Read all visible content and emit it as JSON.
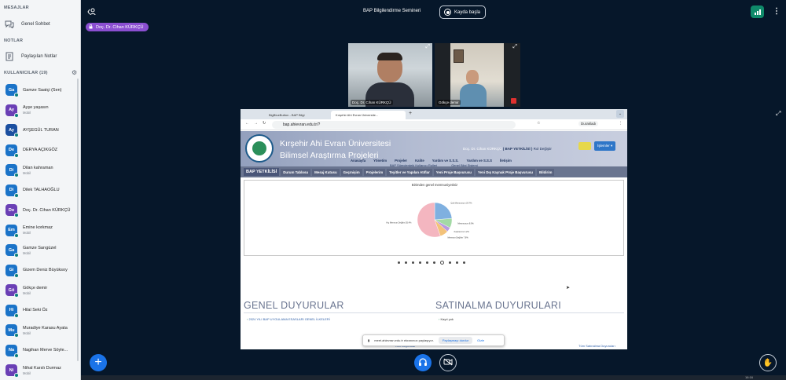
{
  "sidebar": {
    "messages_title": "MESAJLAR",
    "public_chat": "Genel Sohbet",
    "notes_title": "NOTLAR",
    "shared_notes": "Paylaşılan Notlar",
    "users_title": "KULLANICILAR (19)",
    "users": [
      {
        "initials": "Ga",
        "name": "Gamze Saatçi (Sen)",
        "sub": "",
        "color": "#1a73c8"
      },
      {
        "initials": "Ay",
        "name": "Ayşe yaşasın",
        "sub": "Mobil",
        "color": "#6a3fb5"
      },
      {
        "initials": "Ay",
        "name": "AYŞEGÜL TURAN",
        "sub": "",
        "color": "#1b4fa0"
      },
      {
        "initials": "De",
        "name": "DERYA AÇIKGÖZ",
        "sub": "",
        "color": "#1a73c8"
      },
      {
        "initials": "Di",
        "name": "Dilan kahraman",
        "sub": "Mobil",
        "color": "#1a73c8"
      },
      {
        "initials": "Di",
        "name": "Dilek TALHAOĞLU",
        "sub": "",
        "color": "#1a73c8"
      },
      {
        "initials": "Do",
        "name": "Doç. Dr. Cihan KÜRKÇÜ",
        "sub": "",
        "color": "#6a3fb5"
      },
      {
        "initials": "Em",
        "name": "Emine korkmaz",
        "sub": "Mobil",
        "color": "#1a73c8"
      },
      {
        "initials": "Ga",
        "name": "Gamze Sarıgüzel",
        "sub": "Mobil",
        "color": "#1a73c8"
      },
      {
        "initials": "Gi",
        "name": "Gizem Deniz Büyüksoy",
        "sub": "",
        "color": "#1a73c8"
      },
      {
        "initials": "Gö",
        "name": "Gökçe demir",
        "sub": "Mobil",
        "color": "#6a3fb5"
      },
      {
        "initials": "Hi",
        "name": "Hilal Seki Öz",
        "sub": "",
        "color": "#1a73c8"
      },
      {
        "initials": "Mu",
        "name": "Muradiye Karasu Ayata",
        "sub": "Mobil",
        "color": "#1a73c8"
      },
      {
        "initials": "Na",
        "name": "Nagihan Merve Söyle...",
        "sub": "",
        "color": "#1a73c8"
      },
      {
        "initials": "Ni",
        "name": "Nihal Karslı Durmaz",
        "sub": "Mobil",
        "color": "#6a3fb5"
      }
    ]
  },
  "topbar": {
    "meeting_title": "BAP Bilgilendirme Semineri",
    "record_label": "Kayda başla",
    "presenter": "Doç. Dr. Cihan KÜRKÇÜ"
  },
  "webcams": [
    {
      "name": "Doç. Dr. Cihan KÜRKÇÜ"
    },
    {
      "name": "Gökçe demir"
    }
  ],
  "share": {
    "tab1": "BigBlueButton - BAP Bilgi",
    "tab2": "Kırşehir Ahi Evran Üniversite...",
    "url": "bap.ahievran.edu.tr/?",
    "profile": "Durakladı",
    "site_title_1": "Kırşehir Ahi Evran Üniversitesi",
    "site_title_2": "Bilimsel Araştırma Projeleri",
    "site_user": "Doç. Dr. Cihan KÜRKÇÜ",
    "site_role": "( BAP YETKİLİSİ )",
    "site_role_link": "Rol Değiştir",
    "site_menu_btn": "İşlemler",
    "top_links": [
      "Anasayfa",
      "Yönetim",
      "Projeler",
      "Kalite",
      "Yardım ve S.S.S.",
      "Yardım ve S.S.S",
      "İletişim"
    ],
    "sub_links": [
      "BAP Süreçlerdeki Kullanıcı Rolleri",
      "Genel Bilgi Sistemi"
    ],
    "nav": [
      "BAP YETKİLİSİ",
      "Durum Tablosu",
      "Mesaj Kutusu",
      "Geçmişim",
      "Projelerim",
      "Teyitler ve Yapılan Atıflar",
      "Yeni Proje Başvurusu",
      "Yeni Dış Kaynak Proje Başvurusu",
      "Bildirim"
    ],
    "chart_caption": "Birimden genel memnuniyetiniz",
    "announcements_title": "GENEL DUYURULAR",
    "purchase_title": "SATINALMA DUYURULARI",
    "announcement_item": "2024 YILI BAP UYGULAMA ESASLARI GENEL İLKELERİ",
    "purchase_item": "Kayıt yok",
    "all_announcements": "Tüm Duyurular",
    "all_purchases": "Tüm Satınalma Duyuruları",
    "toast_text": "meet.ahievran.edu.tr ekranınızı paylaşıyor.",
    "toast_stop": "Paylaşmayı durdur",
    "toast_hide": "Gizle"
  },
  "chart_data": {
    "type": "pie",
    "title": "Birimden genel memnuniyetiniz",
    "categories": [
      "Çok Memnunum",
      "Memnunum",
      "Kararsızım",
      "Memnun Değilim",
      "Hiç Memnun Değilim"
    ],
    "values": [
      23.7,
      8.9,
      4.2,
      7.8,
      55.4
    ],
    "colors": [
      "#7fb0e0",
      "#a3d9a5",
      "#b89ae0",
      "#f3c27a",
      "#f4b6c0"
    ]
  },
  "taskbar_time": "16:16"
}
